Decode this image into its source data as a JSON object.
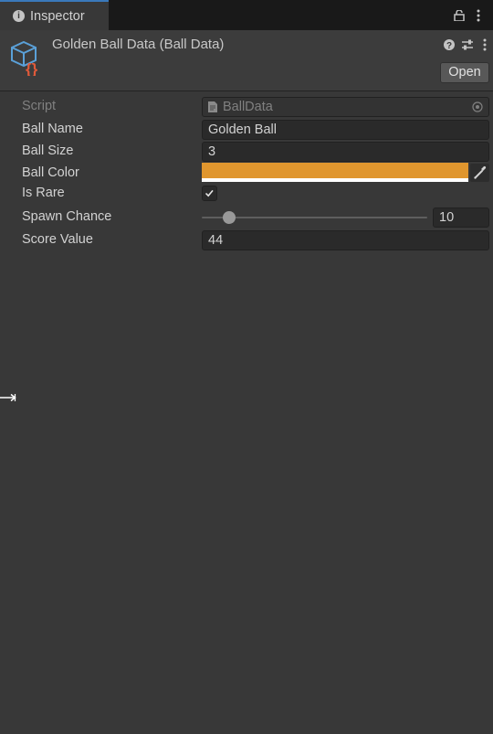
{
  "tab": {
    "label": "Inspector",
    "icon": "info-icon"
  },
  "header": {
    "title": "Golden Ball Data (Ball Data)",
    "open_label": "Open"
  },
  "properties": {
    "script": {
      "label": "Script",
      "value": "BallData"
    },
    "ball_name": {
      "label": "Ball Name",
      "value": "Golden Ball"
    },
    "ball_size": {
      "label": "Ball Size",
      "value": "3"
    },
    "ball_color": {
      "label": "Ball Color",
      "color": "#e0962e"
    },
    "is_rare": {
      "label": "Is Rare",
      "checked": true
    },
    "spawn_chance": {
      "label": "Spawn Chance",
      "value": "10",
      "slider_fraction": 0.12
    },
    "score_value": {
      "label": "Score Value",
      "value": "44"
    }
  },
  "colors": {
    "background": "#383838",
    "tab_accent": "#3a79bb",
    "ball_color": "#e0962e"
  }
}
